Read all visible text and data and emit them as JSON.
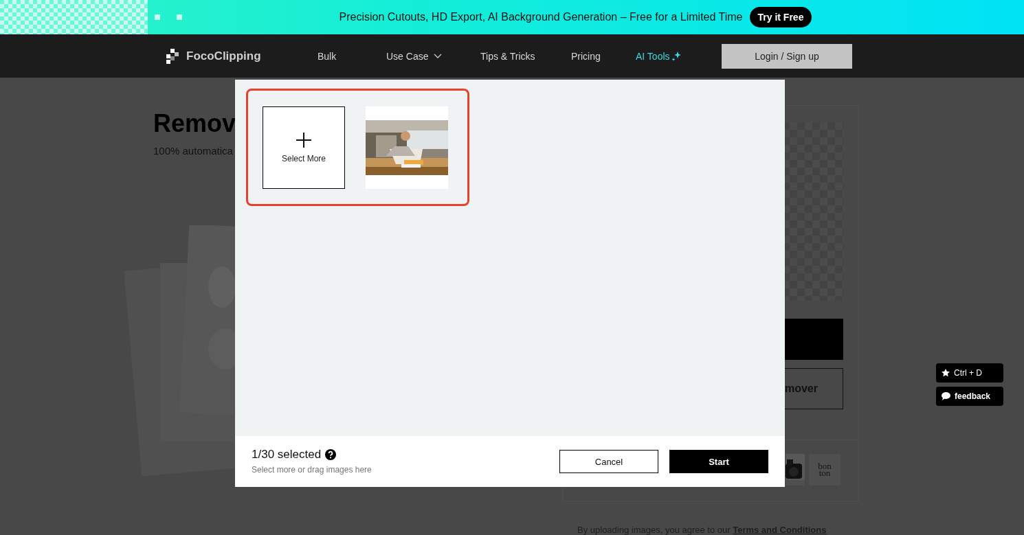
{
  "banner": {
    "message": "Precision Cutouts, HD Export, AI Background Generation – Free for a Limited Time",
    "button": "Try it Free"
  },
  "nav": {
    "logo": "FocoClipping",
    "items": [
      {
        "label": "Bulk",
        "kind": "link"
      },
      {
        "label": "Use Case",
        "kind": "dropdown"
      },
      {
        "label": "Tips & Tricks",
        "kind": "link"
      },
      {
        "label": "Pricing",
        "kind": "link"
      },
      {
        "label": "AI Tools",
        "kind": "ai"
      }
    ],
    "login": "Login / Sign up"
  },
  "page": {
    "heading": "Remov",
    "subheading": "100% automatica",
    "secondary_button": "mover",
    "brand_logo": "bon ton",
    "terms": {
      "text": "By uploading images, you agree to our",
      "link": "Terms and Conditions"
    }
  },
  "dialog": {
    "tiles": [
      {
        "kind": "add",
        "label": "Select More"
      },
      {
        "kind": "picture"
      }
    ],
    "count": "1/30 selected",
    "hint": "Select more or drag images here",
    "buttons": [
      {
        "label": "Cancel",
        "kind": "secondary"
      },
      {
        "label": "Start",
        "kind": "primary"
      }
    ]
  },
  "floating": [
    {
      "label": "Ctrl + D",
      "kind": "bookmark"
    },
    {
      "label": "feedback",
      "kind": "feedback"
    }
  ]
}
